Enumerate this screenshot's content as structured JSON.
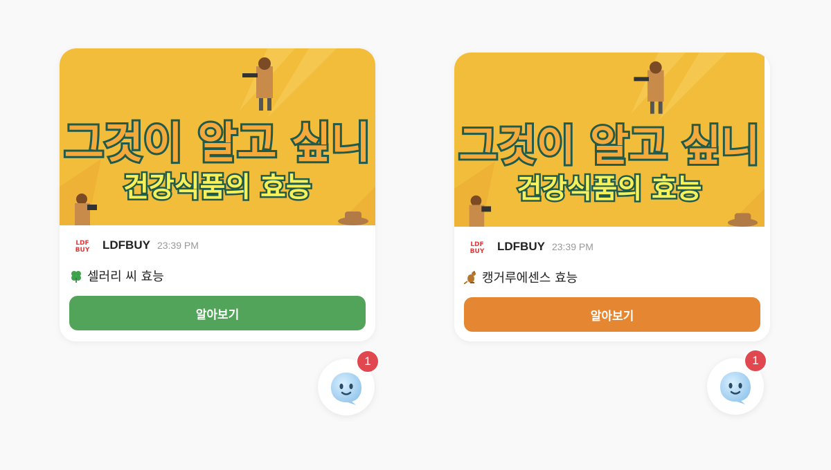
{
  "cards": [
    {
      "banner_title": "그것이 알고 싶니",
      "banner_subtitle": "건강식품의 효능",
      "brand": "LDFBUY",
      "time": "23:39 PM",
      "message_icon": "clover-icon",
      "message": "셀러리 씨 효능",
      "button_label": "알아보기",
      "button_color": "#52a45a"
    },
    {
      "banner_title": "그것이 알고 싶니",
      "banner_subtitle": "건강식품의 효능",
      "brand": "LDFBUY",
      "time": "23:39 PM",
      "message_icon": "kangaroo-icon",
      "message": "캥거루에센스 효능",
      "button_label": "알아보기",
      "button_color": "#e58633"
    }
  ],
  "launchers": [
    {
      "badge": "1",
      "icon": "chat-ghost-icon"
    },
    {
      "badge": "1",
      "icon": "chat-ghost-icon"
    }
  ],
  "colors": {
    "banner_bg": "#f3bd3c",
    "banner_title_fill": "#f5a93a",
    "banner_title_stroke": "#1f5a4a",
    "banner_subtitle_fill": "#f6f05a",
    "badge": "#e0474f"
  }
}
